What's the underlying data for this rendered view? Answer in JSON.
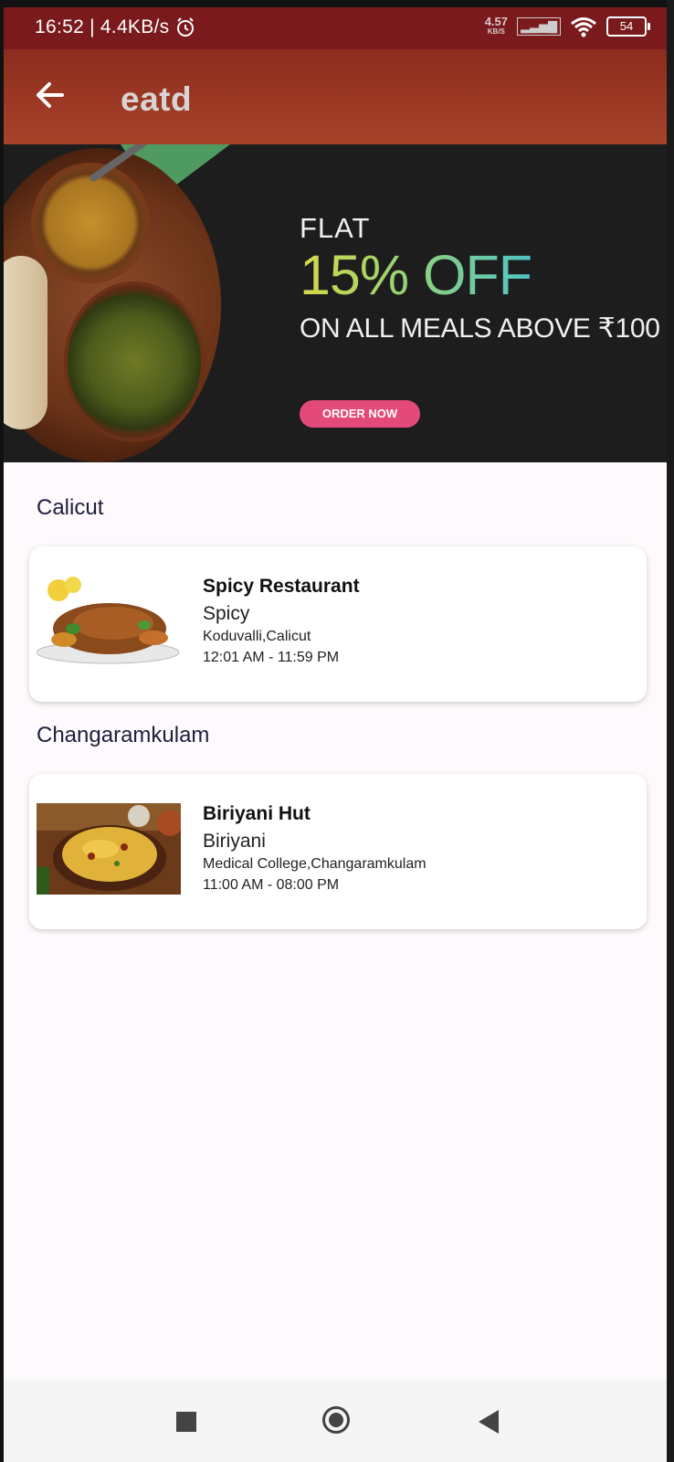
{
  "status_bar": {
    "time": "16:52",
    "net_rate": "4.4KB/s",
    "speed_value": "4.57",
    "speed_unit": "KB/S",
    "battery": "54"
  },
  "app_bar": {
    "title": "eatd"
  },
  "banner": {
    "line1": "FLAT",
    "line2": "15% OFF",
    "line3": "ON ALL MEALS ABOVE ₹100",
    "button": "ORDER NOW"
  },
  "sections": [
    {
      "title": "Calicut",
      "restaurant": {
        "name": "Spicy Restaurant",
        "category": "Spicy",
        "location": "Koduvalli,Calicut",
        "hours": "12:01 AM - 11:59 PM"
      }
    },
    {
      "title": "Changaramkulam",
      "restaurant": {
        "name": "Biriyani Hut",
        "category": "Biriyani",
        "location": "Medical College,Changaramkulam",
        "hours": "11:00 AM - 08:00 PM"
      }
    }
  ]
}
